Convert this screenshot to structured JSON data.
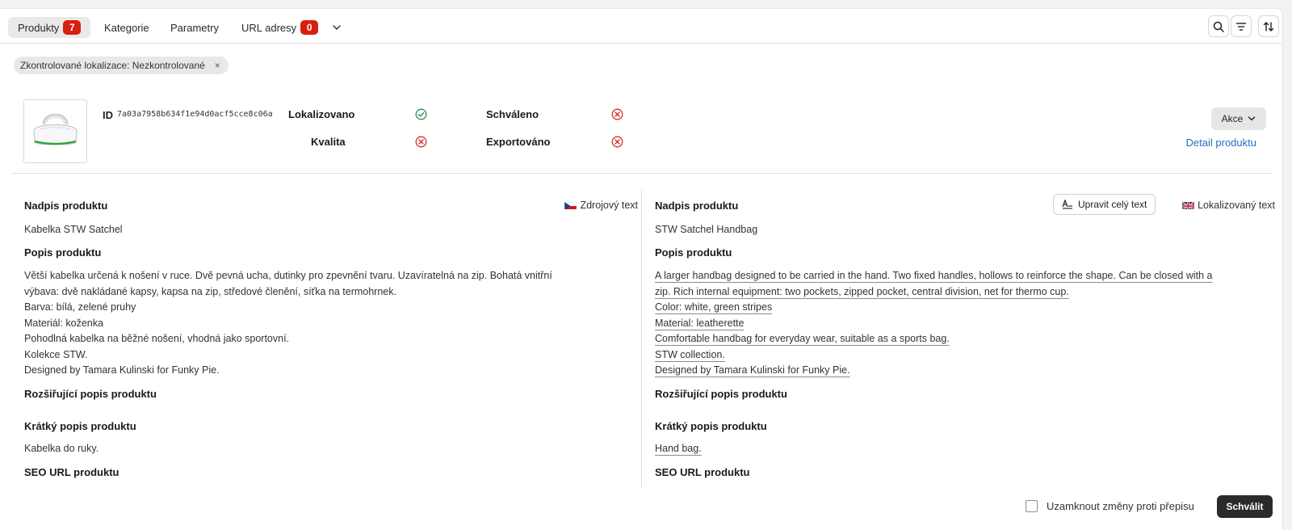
{
  "tabs": [
    {
      "label": "Produkty",
      "badge": "7",
      "active": true
    },
    {
      "label": "Kategorie"
    },
    {
      "label": "Parametry"
    },
    {
      "label": "URL adresy",
      "badge": "0"
    }
  ],
  "toolbar": {
    "icons": [
      "search-icon",
      "filter-icon",
      "sort-icon"
    ]
  },
  "filter_chip": {
    "label": "Zkontrolované lokalizace: Nezkontrolované",
    "close": "×"
  },
  "product": {
    "id_label": "ID",
    "id_value": "7a03a7958b634f1e94d0acf5cce8c06a",
    "statuses": [
      {
        "label": "Lokalizovano",
        "state": "ok"
      },
      {
        "label": "Schváleno",
        "state": "error"
      },
      {
        "label": "Kvalita",
        "state": "error"
      },
      {
        "label": "Exportováno",
        "state": "error"
      }
    ],
    "actions_label": "Akce",
    "detail_link": "Detail produktu"
  },
  "source": {
    "tag": "Zdrojový text",
    "title_heading": "Nadpis produktu",
    "title": "Kabelka STW Satchel",
    "desc_heading": "Popis produktu",
    "desc_lines": [
      "Větší kabelka určená k nošení v ruce. Dvě pevná ucha, dutinky pro zpevnění tvaru. Uzavíratelná na zip. Bohatá vnitřní",
      "výbava: dvě nakládané kapsy, kapsa na zip, středové členění, síťka na termohrnek.",
      "Barva: bílá, zelené pruhy",
      "Materiál: koženka",
      "Pohodlná kabelka na běžné nošení, vhodná jako sportovní.",
      "Kolekce STW.",
      "Designed by Tamara Kulinski for Funky Pie."
    ],
    "ext_heading": "Rozšiřující popis produktu",
    "short_heading": "Krátký popis produktu",
    "short": "Kabelka do ruky.",
    "seo_heading": "SEO URL produktu"
  },
  "localized": {
    "tag": "Lokalizovaný text",
    "edit_button": "Upravit celý text",
    "title_heading": "Nadpis produktu",
    "title": "STW Satchel Handbag",
    "desc_heading": "Popis produktu",
    "desc_lines": [
      "A larger handbag designed to be carried in the hand. Two fixed handles, hollows to reinforce the shape. Can be closed with a",
      "zip. Rich internal equipment: two pockets, zipped pocket, central division, net for thermo cup.",
      "Color: white, green stripes",
      "Material: leatherette",
      "Comfortable handbag for everyday wear, suitable as a sports bag.",
      "STW collection.",
      "Designed by Tamara Kulinski for Funky Pie."
    ],
    "ext_heading": "Rozšiřující popis produktu",
    "short_heading": "Krátký popis produktu",
    "short": "Hand bag.",
    "seo_heading": "SEO URL produktu"
  },
  "footer": {
    "lock_label": "Uzamknout změny proti přepisu",
    "lock_checked": false,
    "approve_button": "Schválit"
  },
  "colors": {
    "badge": "#d81f0f",
    "ok": "#2e8b57",
    "error": "#d42a2a",
    "link": "#2b6cc4",
    "primary_button": "#2b2b2b"
  }
}
